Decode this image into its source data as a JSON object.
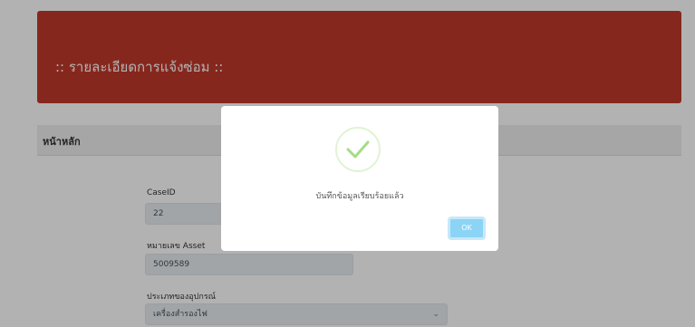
{
  "header": {
    "title": ":: รายละเอียดการแจ้งซ่อม ::"
  },
  "section": {
    "title": "หน้าหลัก"
  },
  "form": {
    "case_id": {
      "label": "CaseID",
      "value": "22"
    },
    "asset_no": {
      "label": "หมายเลข Asset",
      "value": "5009589"
    },
    "device_type": {
      "label": "ประเภทของอุปกรณ์",
      "value": "เครื่องสำรองไฟ"
    }
  },
  "modal": {
    "icon": "success-check-icon",
    "message": "บันทึกข้อมูลเรียบร้อยแล้ว",
    "ok_label": "OK"
  },
  "colors": {
    "banner": "#c0392b",
    "success": "#a5dc86",
    "ok_button": "#8cd4f5"
  }
}
